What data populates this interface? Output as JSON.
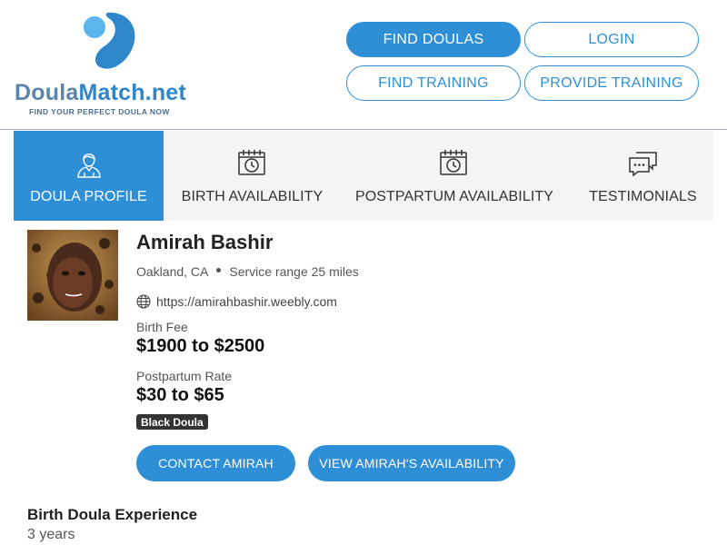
{
  "logo": {
    "name_part1": "Doula",
    "name_part2": "Match.net",
    "tagline": "FIND YOUR PERFECT DOULA NOW"
  },
  "nav": {
    "find_doulas": "FIND DOULAS",
    "login": "LOGIN",
    "find_training": "FIND TRAINING",
    "provide_training": "PROVIDE TRAINING"
  },
  "tabs": [
    {
      "label": "DOULA PROFILE",
      "icon": "doula-person-icon",
      "active": true
    },
    {
      "label": "BIRTH AVAILABILITY",
      "icon": "calendar-clock-icon",
      "active": false
    },
    {
      "label": "POSTPARTUM AVAILABILITY",
      "icon": "calendar-clock-icon",
      "active": false
    },
    {
      "label": "TESTIMONIALS",
      "icon": "chat-bubbles-icon",
      "active": false
    }
  ],
  "profile": {
    "name": "Amirah Bashir",
    "location": "Oakland, CA",
    "service_range": "Service range 25 miles",
    "website": "https://amirahbashir.weebly.com",
    "birth_fee_label": "Birth Fee",
    "birth_fee": "$1900 to $2500",
    "postpartum_label": "Postpartum Rate",
    "postpartum_rate": "$30 to $65",
    "badge": "Black Doula",
    "contact_label": "CONTACT AMIRAH",
    "availability_label": "VIEW AMIRAH'S AVAILABILITY"
  },
  "experience": {
    "title": "Birth Doula Experience",
    "value": "3 years"
  },
  "colors": {
    "accent": "#2f8fd6",
    "tab_bg": "#f4f4f4",
    "badge_bg": "#333333"
  }
}
